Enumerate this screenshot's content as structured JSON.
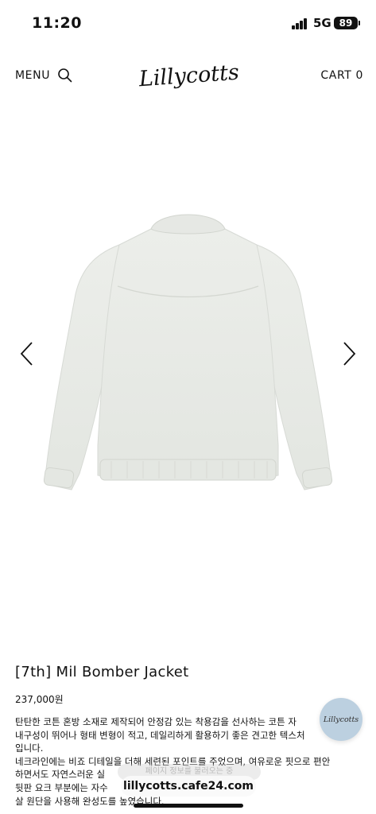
{
  "status_bar": {
    "time": "11:20",
    "network": "5G",
    "battery": "89"
  },
  "header": {
    "menu_label": "MENU",
    "search_icon": "search-icon",
    "logo_text": "Lillycotts",
    "cart_label": "CART 0"
  },
  "gallery": {
    "prev_icon": "chevron-left-icon",
    "next_icon": "chevron-right-icon",
    "image_desc": "jacket-back-view-image"
  },
  "product": {
    "name": "[7th] Mil Bomber Jacket",
    "price": "237,000원",
    "description": [
      "탄탄한 코튼 혼방 소재로 제작되어 안정감 있는 착용감을 선사하는 코튼 자",
      "내구성이 뛰어나 형태 변형이 적고, 데일리하게 활용하기 좋은 견고한 텍스처",
      "입니다.",
      "네크라인에는 비죠 디테일을 더해 세련된 포인트를 주었으며, 여유로운 핏으로 편안",
      "하면서도 자연스러운 실",
      "뒷판 요크 부분에는 자수",
      "살 원단을 사용해 완성도를 높였습니다."
    ]
  },
  "floating": {
    "chat_logo": "Lillycotts",
    "toast_text": "페이지 정보를 불러오는 중",
    "url": "lillycotts.cafe24.com"
  },
  "colors": {
    "fab_bg": "#bcd0e0",
    "jacket": "#e9ebe7"
  }
}
